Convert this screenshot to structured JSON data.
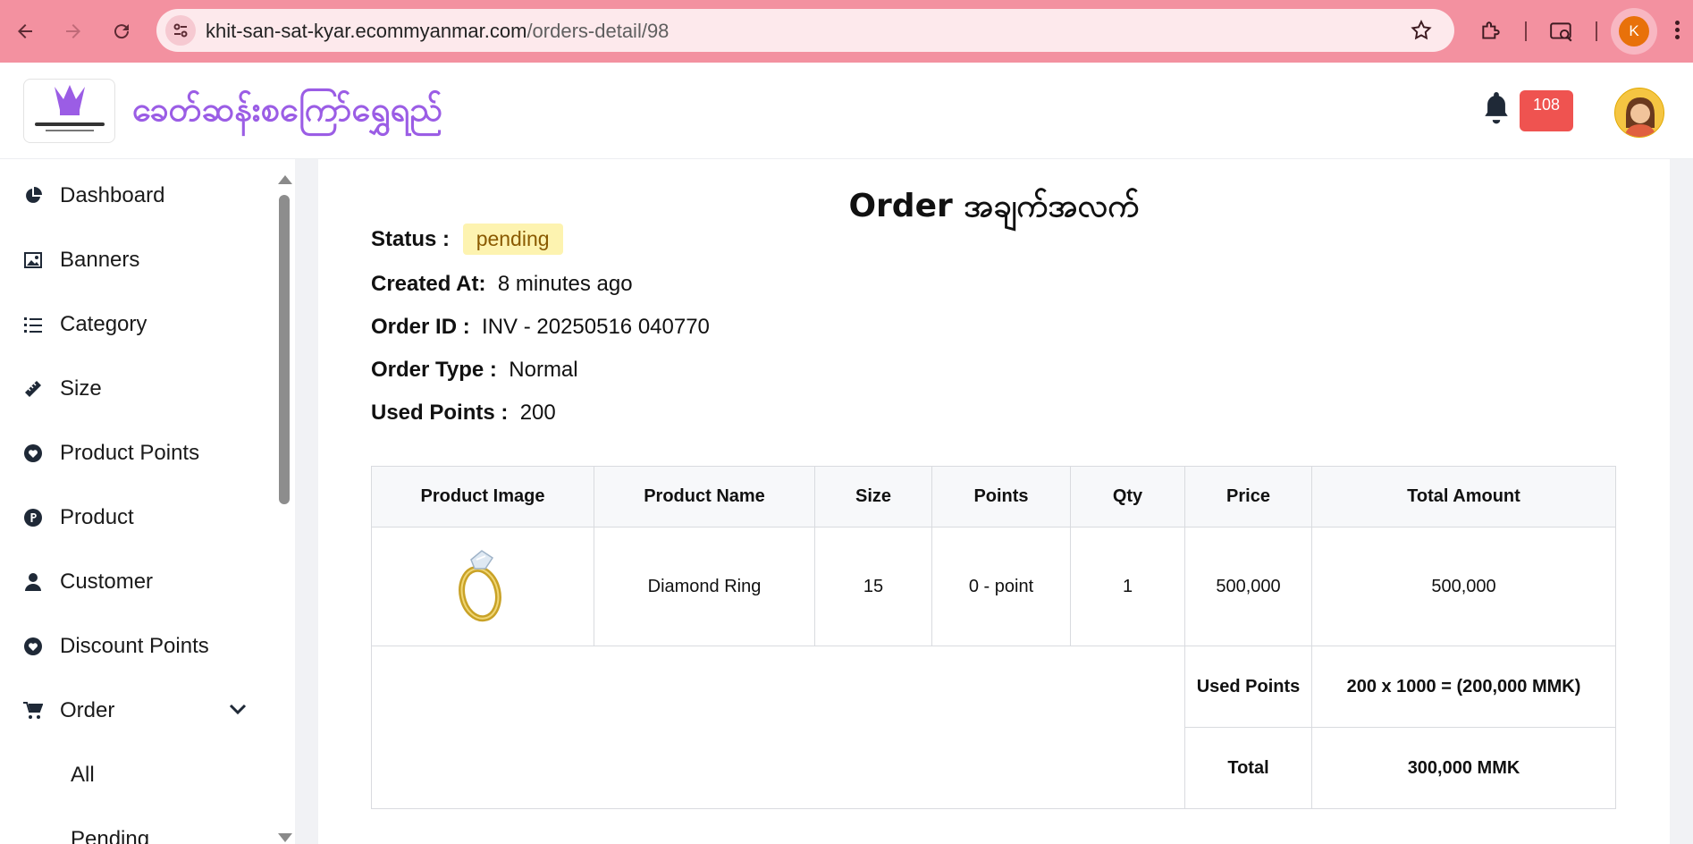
{
  "browser": {
    "url_domain": "khit-san-sat-kyar.ecommyanmar.com",
    "url_path": "/orders-detail/98",
    "profile_initial": "K"
  },
  "header": {
    "brand_name": "ခေတ်ဆန်းစကြော်ရွှေရည်",
    "notification_count": "108",
    "colors": {
      "brand": "#9b5de5",
      "badge": "#ef5350"
    }
  },
  "sidebar": {
    "items": [
      {
        "label": "Dashboard",
        "icon": "pie-chart-icon"
      },
      {
        "label": "Banners",
        "icon": "image-icon"
      },
      {
        "label": "Category",
        "icon": "list-icon"
      },
      {
        "label": "Size",
        "icon": "ruler-icon"
      },
      {
        "label": "Product Points",
        "icon": "heart-badge-icon"
      },
      {
        "label": "Product",
        "icon": "p-circle-icon"
      },
      {
        "label": "Customer",
        "icon": "user-icon"
      },
      {
        "label": "Discount Points",
        "icon": "heart-badge-icon"
      },
      {
        "label": "Order",
        "icon": "cart-icon"
      }
    ],
    "order_sub_items": [
      "All",
      "Pending"
    ]
  },
  "order": {
    "title": "Order အချက်အလက်",
    "status_label": "Status :",
    "status_value": "pending",
    "created_label": "Created At:",
    "created_value": "8 minutes ago",
    "id_label": "Order ID :",
    "id_value": "INV - 20250516 040770",
    "type_label": "Order Type :",
    "type_value": "Normal",
    "points_label": "Used Points :",
    "points_value": "200"
  },
  "table": {
    "headers": [
      "Product Image",
      "Product Name",
      "Size",
      "Points",
      "Qty",
      "Price",
      "Total Amount"
    ],
    "rows": [
      {
        "name": "Diamond Ring",
        "size": "15",
        "points": "0 - point",
        "qty": "1",
        "price": "500,000",
        "total": "500,000"
      }
    ],
    "used_points_label": "Used Points",
    "used_points_value": "200 x 1000 = (200,000 MMK)",
    "total_label": "Total",
    "total_value": "300,000 MMK"
  }
}
